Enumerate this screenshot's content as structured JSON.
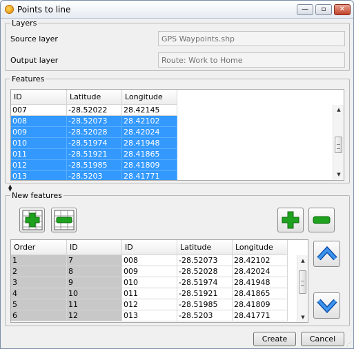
{
  "window": {
    "title": "Points to line",
    "controls": {
      "minimize": "—",
      "maximize": "▫",
      "close": "✕"
    }
  },
  "layers": {
    "group_title": "Layers",
    "source_label": "Source layer",
    "source_value": "GPS Waypoints.shp",
    "output_label": "Output layer",
    "output_value": "Route: Work to Home"
  },
  "features": {
    "group_title": "Features",
    "columns": [
      "ID",
      "Latitude",
      "Longitude"
    ],
    "rows": [
      {
        "id": "007",
        "lat": "-28.52022",
        "lon": "28.42145",
        "selected": false
      },
      {
        "id": "008",
        "lat": "-28.52073",
        "lon": "28.42102",
        "selected": true
      },
      {
        "id": "009",
        "lat": "-28.52028",
        "lon": "28.42024",
        "selected": true
      },
      {
        "id": "010",
        "lat": "-28.51974",
        "lon": "28.41948",
        "selected": true
      },
      {
        "id": "011",
        "lat": "-28.51921",
        "lon": "28.41865",
        "selected": true
      },
      {
        "id": "012",
        "lat": "-28.51985",
        "lon": "28.41809",
        "selected": true
      },
      {
        "id": "013",
        "lat": "-28.5203",
        "lon": "28.41771",
        "selected": true
      }
    ]
  },
  "new_features": {
    "group_title": "New features",
    "columns": [
      "Order",
      "ID",
      "ID",
      "Latitude",
      "Longitude"
    ],
    "rows": [
      {
        "order": "1",
        "fid": "7",
        "id": "008",
        "lat": "-28.52073",
        "lon": "28.42102"
      },
      {
        "order": "2",
        "fid": "8",
        "id": "009",
        "lat": "-28.52028",
        "lon": "28.42024"
      },
      {
        "order": "3",
        "fid": "9",
        "id": "010",
        "lat": "-28.51974",
        "lon": "28.41948"
      },
      {
        "order": "4",
        "fid": "10",
        "id": "011",
        "lat": "-28.51921",
        "lon": "28.41865"
      },
      {
        "order": "5",
        "fid": "11",
        "id": "012",
        "lat": "-28.51985",
        "lon": "28.41809"
      },
      {
        "order": "6",
        "fid": "12",
        "id": "013",
        "lat": "-28.5203",
        "lon": "28.41771"
      }
    ]
  },
  "buttons": {
    "create": "Create",
    "cancel": "Cancel"
  },
  "icons": {
    "add_all": "add-all-icon",
    "remove_all": "remove-all-icon",
    "add": "plus-icon",
    "remove": "minus-icon",
    "move_up": "chevron-up-icon",
    "move_down": "chevron-down-icon"
  },
  "colors": {
    "selection": "#3399ff",
    "icon_green": "#1fa21f",
    "arrow_blue": "#1f72d6"
  }
}
